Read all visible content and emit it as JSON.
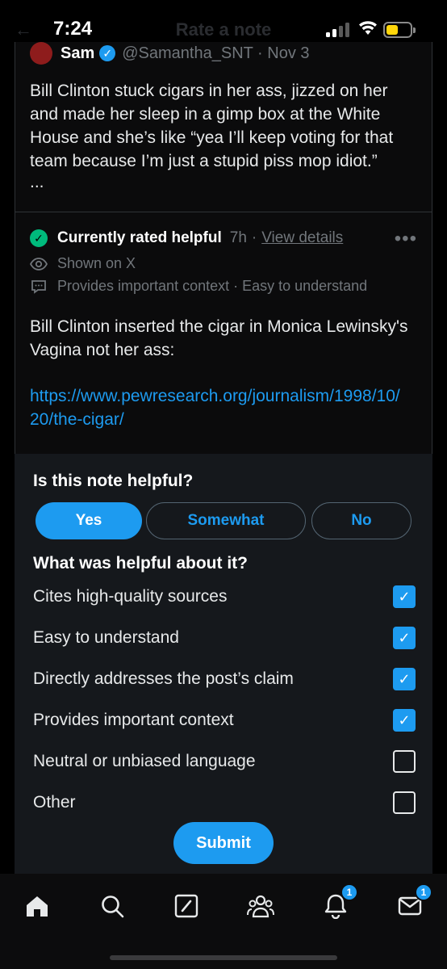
{
  "status_bar": {
    "time": "7:24"
  },
  "header": {
    "title": "Rate a note"
  },
  "post": {
    "name": "Sam",
    "handle_date": "@Samantha_SNT · Nov 3",
    "text": "Bill Clinton stuck cigars in her ass, jizzed on her and made her sleep in a gimp box at the White House and she’s like “yea I’ll keep voting for that team because I’m just a stupid piss mop idiot.”",
    "ellipsis": "..."
  },
  "note": {
    "status": "Currently rated helpful",
    "age": "7h",
    "separator": "·",
    "view_details": "View details",
    "shown_on": "Shown on X",
    "tags": "Provides important context · Easy to understand",
    "text": "Bill Clinton inserted the cigar in Monica Lewinsky's Vagina not her ass:",
    "link": "https://www.pewresearch.org/journalism/1998/10/20/the-cigar/"
  },
  "rating": {
    "question": "Is this note helpful?",
    "choices": {
      "yes": "Yes",
      "somewhat": "Somewhat",
      "no": "No"
    },
    "selected": "Yes",
    "followup": "What was helpful about it?",
    "options": [
      {
        "label": "Cites high-quality sources",
        "checked": true
      },
      {
        "label": "Easy to understand",
        "checked": true
      },
      {
        "label": "Directly addresses the post’s claim",
        "checked": true
      },
      {
        "label": "Provides important context",
        "checked": true
      },
      {
        "label": "Neutral or unbiased language",
        "checked": false
      },
      {
        "label": "Other",
        "checked": false
      }
    ],
    "submit": "Submit"
  },
  "tabbar": {
    "items": [
      "home-icon",
      "search-icon",
      "grok-icon",
      "communities-icon",
      "notifications-icon",
      "messages-icon"
    ],
    "notifications_badge": "1",
    "messages_badge": "1"
  },
  "colors": {
    "accent": "#1d9bf0",
    "helpful": "#00ba7c",
    "sheet": "#15181c"
  }
}
